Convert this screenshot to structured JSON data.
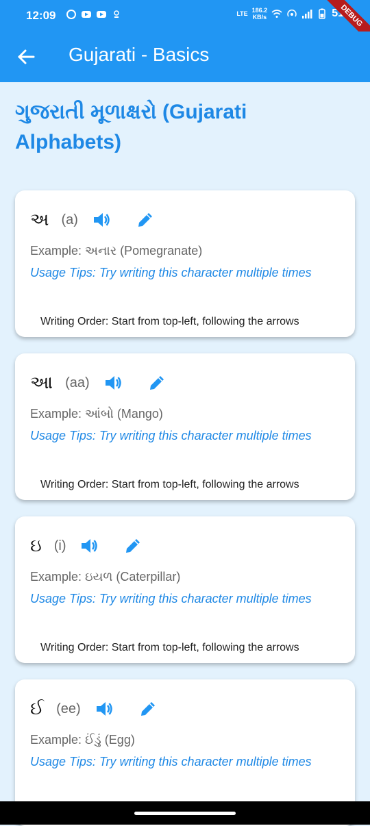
{
  "status_bar": {
    "time": "12:09",
    "speed_value": "186.2",
    "speed_unit": "KB/s",
    "network_label": "LTE",
    "battery": "51"
  },
  "debug_ribbon": "DEBUG",
  "appbar": {
    "title": "Gujarati - Basics",
    "back_icon": "arrow-back-icon"
  },
  "section": {
    "title": "ગુજરાતી મૂળાક્ષરો (Gujarati Alphabets)"
  },
  "cards": [
    {
      "letter": "અ",
      "translit": "(a)",
      "example": "Example: અનાર (Pomegranate)",
      "tips": "Usage Tips: Try writing this character multiple times",
      "order": "Writing Order: Start from top-left, following the arrows"
    },
    {
      "letter": "આ",
      "translit": "(aa)",
      "example": "Example: આંબો (Mango)",
      "tips": "Usage Tips: Try writing this character multiple times",
      "order": "Writing Order: Start from top-left, following the arrows"
    },
    {
      "letter": "ઇ",
      "translit": "(i)",
      "example": "Example: ઇયળ (Caterpillar)",
      "tips": "Usage Tips: Try writing this character multiple times",
      "order": "Writing Order: Start from top-left, following the arrows"
    },
    {
      "letter": "ઈ",
      "translit": "(ee)",
      "example": "Example: ઈંડું (Egg)",
      "tips": "Usage Tips: Try writing this character multiple times",
      "order": ""
    }
  ],
  "colors": {
    "primary": "#2196f3",
    "accent_text": "#1e88e5",
    "background": "#e3f2fd"
  }
}
